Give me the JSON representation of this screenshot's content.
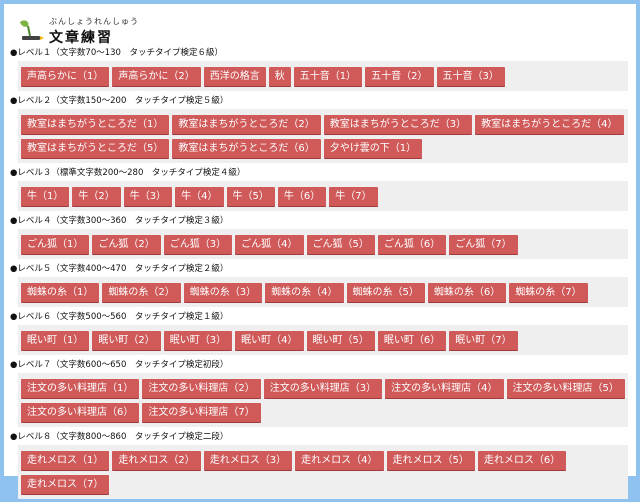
{
  "header": {
    "ruby": "ぶんしょうれんしゅう",
    "title": "文章練習"
  },
  "colors": {
    "background": "#8fc2ee",
    "button": "#d05a5a",
    "button_text": "#ffffff",
    "group_background": "#efefef"
  },
  "levels": [
    {
      "heading": "●レベル１（文字数70～130　タッチタイプ検定６級）",
      "buttons": [
        "声高らかに（1）",
        "声高らかに（2）",
        "西洋の格言",
        "秋",
        "五十音（1）",
        "五十音（2）",
        "五十音（3）"
      ]
    },
    {
      "heading": "●レベル２（文字数150～200　タッチタイプ検定５級）",
      "buttons": [
        "教室はまちがうところだ（1）",
        "教室はまちがうところだ（2）",
        "教室はまちがうところだ（3）",
        "教室はまちがうところだ（4）",
        "教室はまちがうところだ（5）",
        "教室はまちがうところだ（6）",
        "夕やけ雲の下（1）"
      ]
    },
    {
      "heading": "●レベル３（標準文字数200～280　タッチタイプ検定４級）",
      "buttons": [
        "牛（1）",
        "牛（2）",
        "牛（3）",
        "牛（4）",
        "牛（5）",
        "牛（6）",
        "牛（7）"
      ]
    },
    {
      "heading": "●レベル４（文字数300～360　タッチタイプ検定３級）",
      "buttons": [
        "ごん狐（1）",
        "ごん狐（2）",
        "ごん狐（3）",
        "ごん狐（4）",
        "ごん狐（5）",
        "ごん狐（6）",
        "ごん狐（7）"
      ]
    },
    {
      "heading": "●レベル５（文字数400～470　タッチタイプ検定２級）",
      "buttons": [
        "蜘蛛の糸（1）",
        "蜘蛛の糸（2）",
        "蜘蛛の糸（3）",
        "蜘蛛の糸（4）",
        "蜘蛛の糸（5）",
        "蜘蛛の糸（6）",
        "蜘蛛の糸（7）"
      ]
    },
    {
      "heading": "●レベル６（文字数500～560　タッチタイプ検定１級）",
      "buttons": [
        "眠い町（1）",
        "眠い町（2）",
        "眠い町（3）",
        "眠い町（4）",
        "眠い町（5）",
        "眠い町（6）",
        "眠い町（7）"
      ]
    },
    {
      "heading": "●レベル７（文字数600～650　タッチタイプ検定初段）",
      "buttons": [
        "注文の多い料理店（1）",
        "注文の多い料理店（2）",
        "注文の多い料理店（3）",
        "注文の多い料理店（4）",
        "注文の多い料理店（5）",
        "注文の多い料理店（6）",
        "注文の多い料理店（7）"
      ]
    },
    {
      "heading": "●レベル８（文字数800～860　タッチタイプ検定二段）",
      "buttons": [
        "走れメロス（1）",
        "走れメロス（2）",
        "走れメロス（3）",
        "走れメロス（4）",
        "走れメロス（5）",
        "走れメロス（6）",
        "走れメロス（7）"
      ]
    }
  ]
}
